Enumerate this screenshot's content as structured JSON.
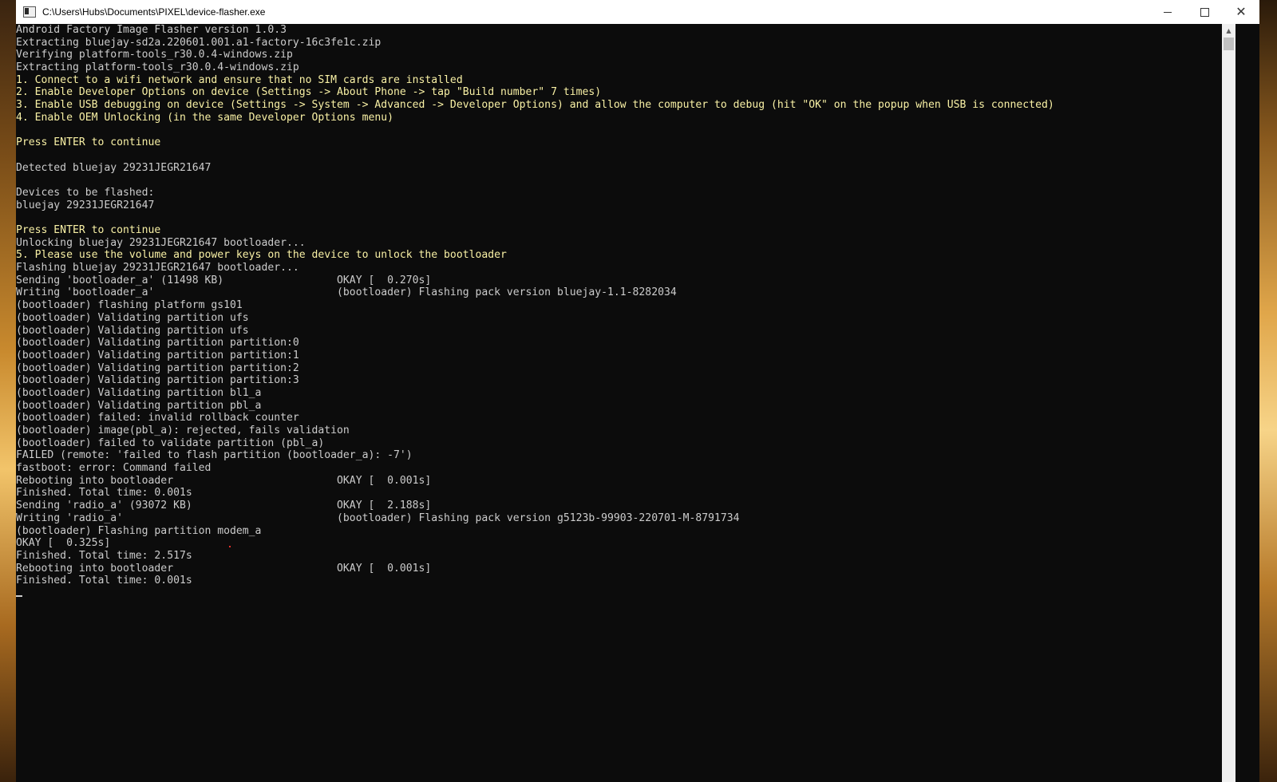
{
  "window": {
    "title": "C:\\Users\\Hubs\\Documents\\PIXEL\\device-flasher.exe",
    "controls": {
      "minimize": "minimize",
      "maximize": "maximize",
      "close": "close"
    }
  },
  "console": {
    "text_color": "#cccccc",
    "highlight_color": "#f9f1a5",
    "background": "#0c0c0c",
    "lines": [
      {
        "text": "Android Factory Image Flasher version 1.0.3",
        "style": "normal"
      },
      {
        "text": "Extracting bluejay-sd2a.220601.001.a1-factory-16c3fe1c.zip",
        "style": "normal"
      },
      {
        "text": "Verifying platform-tools_r30.0.4-windows.zip",
        "style": "normal"
      },
      {
        "text": "Extracting platform-tools_r30.0.4-windows.zip",
        "style": "normal"
      },
      {
        "text": "1. Connect to a wifi network and ensure that no SIM cards are installed",
        "style": "yellow"
      },
      {
        "text": "2. Enable Developer Options on device (Settings -> About Phone -> tap \"Build number\" 7 times)",
        "style": "yellow"
      },
      {
        "text": "3. Enable USB debugging on device (Settings -> System -> Advanced -> Developer Options) and allow the computer to debug (hit \"OK\" on the popup when USB is connected)",
        "style": "yellow"
      },
      {
        "text": "4. Enable OEM Unlocking (in the same Developer Options menu)",
        "style": "yellow"
      },
      {
        "text": "",
        "style": "normal"
      },
      {
        "text": "Press ENTER to continue",
        "style": "yellow"
      },
      {
        "text": "",
        "style": "normal"
      },
      {
        "text": "Detected bluejay 29231JEGR21647",
        "style": "normal"
      },
      {
        "text": "",
        "style": "normal"
      },
      {
        "text": "Devices to be flashed:",
        "style": "normal"
      },
      {
        "text": "bluejay 29231JEGR21647",
        "style": "normal"
      },
      {
        "text": "",
        "style": "normal"
      },
      {
        "text": "Press ENTER to continue",
        "style": "yellow"
      },
      {
        "text": "Unlocking bluejay 29231JEGR21647 bootloader...",
        "style": "normal"
      },
      {
        "text": "5. Please use the volume and power keys on the device to unlock the bootloader",
        "style": "yellow"
      },
      {
        "text": "Flashing bluejay 29231JEGR21647 bootloader...",
        "style": "normal"
      },
      {
        "text": "Sending 'bootloader_a' (11498 KB)                  OKAY [  0.270s]",
        "style": "normal"
      },
      {
        "text": "Writing 'bootloader_a'                             (bootloader) Flashing pack version bluejay-1.1-8282034",
        "style": "normal"
      },
      {
        "text": "(bootloader) flashing platform gs101",
        "style": "normal"
      },
      {
        "text": "(bootloader) Validating partition ufs",
        "style": "normal"
      },
      {
        "text": "(bootloader) Validating partition ufs",
        "style": "normal"
      },
      {
        "text": "(bootloader) Validating partition partition:0",
        "style": "normal"
      },
      {
        "text": "(bootloader) Validating partition partition:1",
        "style": "normal"
      },
      {
        "text": "(bootloader) Validating partition partition:2",
        "style": "normal"
      },
      {
        "text": "(bootloader) Validating partition partition:3",
        "style": "normal"
      },
      {
        "text": "(bootloader) Validating partition bl1_a",
        "style": "normal"
      },
      {
        "text": "(bootloader) Validating partition pbl_a",
        "style": "normal"
      },
      {
        "text": "(bootloader) failed: invalid rollback counter",
        "style": "normal"
      },
      {
        "text": "(bootloader) image(pbl_a): rejected, fails validation",
        "style": "normal"
      },
      {
        "text": "(bootloader) failed to validate partition (pbl_a)",
        "style": "normal"
      },
      {
        "text": "FAILED (remote: 'failed to flash partition (bootloader_a): -7')",
        "style": "normal"
      },
      {
        "text": "fastboot: error: Command failed",
        "style": "normal"
      },
      {
        "text": "Rebooting into bootloader                          OKAY [  0.001s]",
        "style": "normal"
      },
      {
        "text": "Finished. Total time: 0.001s",
        "style": "normal"
      },
      {
        "text": "Sending 'radio_a' (93072 KB)                       OKAY [  2.188s]",
        "style": "normal"
      },
      {
        "text": "Writing 'radio_a'                                  (bootloader) Flashing pack version g5123b-99903-220701-M-8791734",
        "style": "normal"
      },
      {
        "text": "(bootloader) Flashing partition modem_a",
        "style": "normal"
      },
      {
        "text": "OKAY [  0.325s]",
        "style": "normal"
      },
      {
        "text": "Finished. Total time: 2.517s",
        "style": "normal"
      },
      {
        "text": "Rebooting into bootloader                          OKAY [  0.001s]",
        "style": "normal"
      },
      {
        "text": "Finished. Total time: 0.001s",
        "style": "normal"
      }
    ]
  },
  "scrollbar": {
    "up_arrow": "▲"
  }
}
